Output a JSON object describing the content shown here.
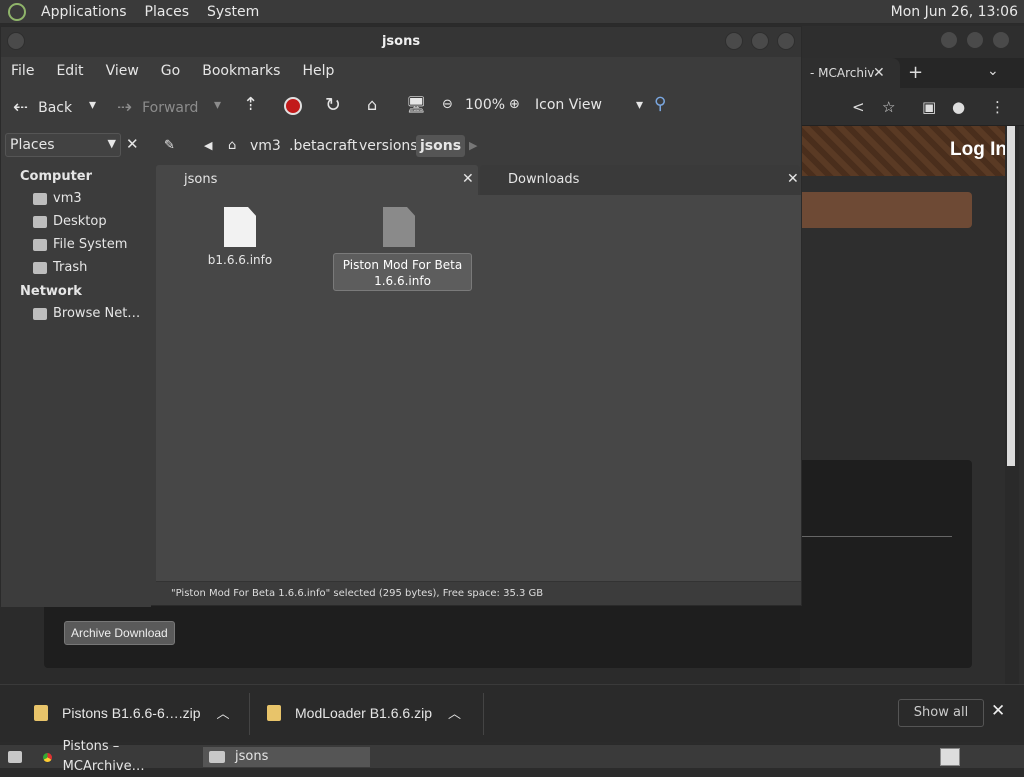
{
  "top_panel": {
    "menus": [
      "Applications",
      "Places",
      "System"
    ],
    "clock": "Mon Jun 26, 13:06"
  },
  "browser": {
    "tab_title": "- MCArchiv",
    "login": "Log In",
    "archive_button": "Archive Download"
  },
  "downloads": {
    "items": [
      "Pistons B1.6.6-6….zip",
      "ModLoader B1.6.6.zip"
    ],
    "show_all": "Show all"
  },
  "taskbar": {
    "tasks": [
      "Pistons – MCArchive…",
      "jsons"
    ]
  },
  "file_manager": {
    "title": "jsons",
    "menu": [
      "File",
      "Edit",
      "View",
      "Go",
      "Bookmarks",
      "Help"
    ],
    "toolbar": {
      "back": "Back",
      "forward": "Forward",
      "zoom": "100%",
      "view_mode": "Icon View"
    },
    "breadcrumbs": [
      "vm3",
      ".betacraft",
      "versions",
      "jsons"
    ],
    "sidebar": {
      "header": "Places",
      "sections": [
        {
          "title": "Computer",
          "items": [
            "vm3",
            "Desktop",
            "File System",
            "Trash"
          ]
        },
        {
          "title": "Network",
          "items": [
            "Browse Net…"
          ]
        }
      ]
    },
    "tabs": [
      "jsons",
      "Downloads"
    ],
    "files": [
      {
        "name": "b1.6.6.info"
      },
      {
        "name_line1": "Piston Mod For Beta",
        "name_line2": "1.6.6.info"
      }
    ],
    "status": "\"Piston Mod For Beta 1.6.6.info\" selected (295 bytes), Free space: 35.3 GB"
  }
}
